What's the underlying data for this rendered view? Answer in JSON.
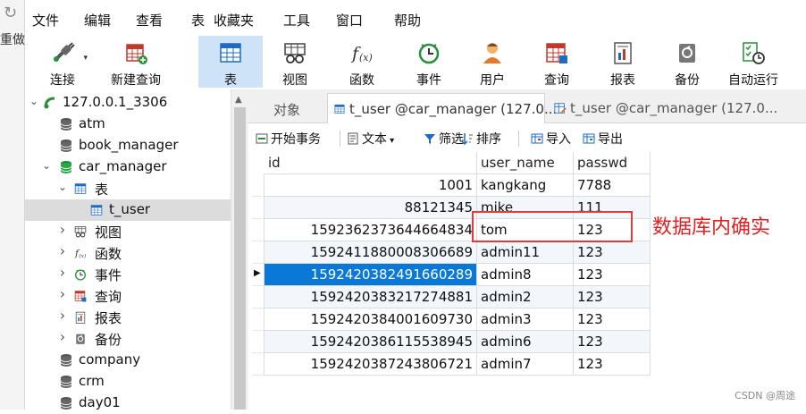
{
  "left_strip": {
    "refresh_glyph": "↻",
    "redo_label": "重做"
  },
  "menu": [
    "文件",
    "编辑",
    "查看",
    "表",
    "收藏夹",
    "工具",
    "窗口",
    "帮助"
  ],
  "toolbar": [
    {
      "label": "连接",
      "icon": "plug-connection-icon",
      "active": false,
      "dropdown": true
    },
    {
      "label": "新建查询",
      "icon": "new-query-icon",
      "active": false,
      "dropdown": false
    },
    {
      "label": "表",
      "icon": "table-icon",
      "active": true,
      "dropdown": false
    },
    {
      "label": "视图",
      "icon": "view-icon",
      "active": false,
      "dropdown": false
    },
    {
      "label": "函数",
      "icon": "function-icon",
      "active": false,
      "dropdown": false
    },
    {
      "label": "事件",
      "icon": "clock-event-icon",
      "active": false,
      "dropdown": false
    },
    {
      "label": "用户",
      "icon": "user-icon",
      "active": false,
      "dropdown": false
    },
    {
      "label": "查询",
      "icon": "query-icon",
      "active": false,
      "dropdown": false
    },
    {
      "label": "报表",
      "icon": "report-icon",
      "active": false,
      "dropdown": false
    },
    {
      "label": "备份",
      "icon": "backup-icon",
      "active": false,
      "dropdown": false
    },
    {
      "label": "自动运行",
      "icon": "auto-run-icon",
      "active": false,
      "dropdown": false
    }
  ],
  "tree": [
    {
      "label": "127.0.0.1_3306",
      "level": 0,
      "arrow": "down",
      "icon": "connection-icon"
    },
    {
      "label": "atm",
      "level": 1,
      "arrow": "",
      "icon": "database-icon"
    },
    {
      "label": "book_manager",
      "level": 1,
      "arrow": "",
      "icon": "database-icon"
    },
    {
      "label": "car_manager",
      "level": 1,
      "arrow": "down",
      "icon": "database-open-icon"
    },
    {
      "label": "表",
      "level": 2,
      "arrow": "down",
      "icon": "table-icon"
    },
    {
      "label": "t_user",
      "level": 3,
      "arrow": "",
      "icon": "table-icon",
      "selected": true
    },
    {
      "label": "视图",
      "level": 2,
      "arrow": "right",
      "icon": "view-icon"
    },
    {
      "label": "函数",
      "level": 2,
      "arrow": "right",
      "icon": "function-icon"
    },
    {
      "label": "事件",
      "level": 2,
      "arrow": "right",
      "icon": "clock-event-icon"
    },
    {
      "label": "查询",
      "level": 2,
      "arrow": "right",
      "icon": "query-icon"
    },
    {
      "label": "报表",
      "level": 2,
      "arrow": "right",
      "icon": "report-icon"
    },
    {
      "label": "备份",
      "level": 2,
      "arrow": "right",
      "icon": "backup-icon"
    },
    {
      "label": "company",
      "level": 1,
      "arrow": "",
      "icon": "database-icon"
    },
    {
      "label": "crm",
      "level": 1,
      "arrow": "",
      "icon": "database-icon"
    },
    {
      "label": "day01",
      "level": 1,
      "arrow": "",
      "icon": "database-icon"
    }
  ],
  "tabs": [
    {
      "label": "对象",
      "icon": "",
      "active": false
    },
    {
      "label": "t_user @car_manager (127.0...",
      "icon": "table-icon",
      "active": true
    },
    {
      "label": "t_user @car_manager (127.0...",
      "icon": "design-table-icon",
      "active": false
    }
  ],
  "subtoolbar": [
    {
      "label": "开始事务",
      "icon": "transaction-icon"
    },
    {
      "label": "文本",
      "icon": "text-icon",
      "dropdown": true
    },
    {
      "label": "筛选",
      "icon": "filter-icon"
    },
    {
      "label": "排序",
      "icon": "sort-icon"
    },
    {
      "label": "导入",
      "icon": "import-icon"
    },
    {
      "label": "导出",
      "icon": "export-icon"
    }
  ],
  "grid": {
    "columns": [
      "id",
      "user_name",
      "passwd"
    ],
    "rows": [
      [
        "1001",
        "kangkang",
        "7788"
      ],
      [
        "88121345",
        "mike",
        "111"
      ],
      [
        "1592362373644664834",
        "tom",
        "123"
      ],
      [
        "1592411880008306689",
        "admin11",
        "123"
      ],
      [
        "1592420382491660289",
        "admin8",
        "123"
      ],
      [
        "1592420383217274881",
        "admin2",
        "123"
      ],
      [
        "1592420384001609730",
        "admin3",
        "123"
      ],
      [
        "1592420386115538945",
        "admin6",
        "123"
      ],
      [
        "1592420387243806721",
        "admin7",
        "123"
      ]
    ],
    "selected_row": 4
  },
  "annotation": "数据库内确实",
  "watermark": "CSDN @周途",
  "colors": {
    "accent": "#0a78d7",
    "annotation": "#e02020",
    "active_tool": "#cfe3f8"
  }
}
